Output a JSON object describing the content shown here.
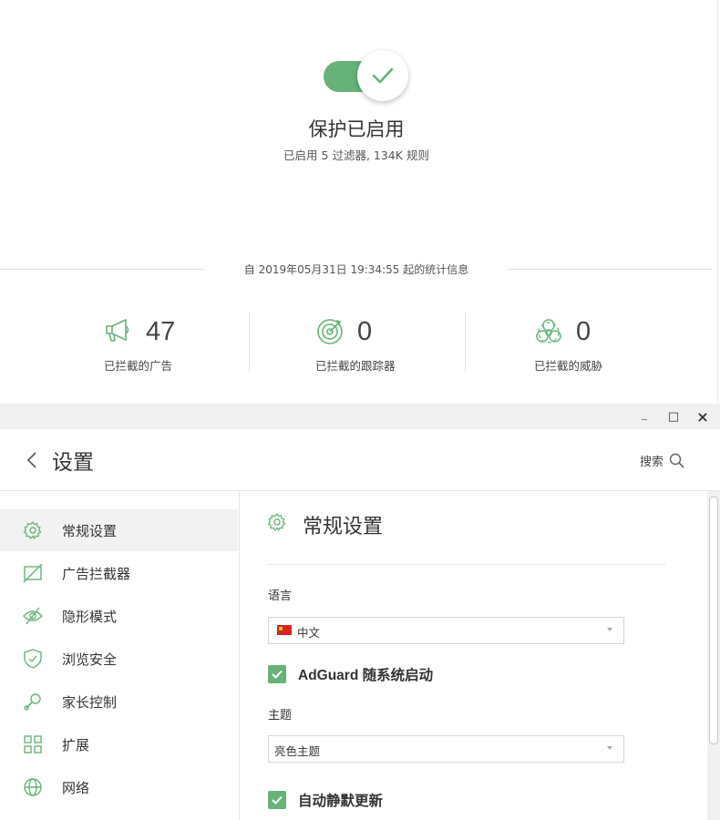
{
  "protection": {
    "title": "保护已启用",
    "subtitle": "已启用 5 过滤器, 134K 规则",
    "enabled": true
  },
  "stats": {
    "since": "自 2019年05月31日 19:34:55 起的统计信息",
    "items": [
      {
        "value": "47",
        "label": "已拦截的广告",
        "icon": "megaphone-icon"
      },
      {
        "value": "0",
        "label": "已拦截的跟踪器",
        "icon": "target-icon"
      },
      {
        "value": "0",
        "label": "已拦截的威胁",
        "icon": "biohazard-icon"
      }
    ]
  },
  "window": {
    "minimize": "_",
    "maximize": "□",
    "close": "×"
  },
  "header": {
    "title": "设置",
    "search_label": "搜索"
  },
  "sidebar": {
    "items": [
      {
        "label": "常规设置",
        "icon": "gear-icon",
        "active": true
      },
      {
        "label": "广告拦截器",
        "icon": "ad-blocker-icon",
        "active": false
      },
      {
        "label": "隐形模式",
        "icon": "eye-slash-icon",
        "active": false
      },
      {
        "label": "浏览安全",
        "icon": "shield-icon",
        "active": false
      },
      {
        "label": "家长控制",
        "icon": "rattle-icon",
        "active": false
      },
      {
        "label": "扩展",
        "icon": "grid-icon",
        "active": false
      },
      {
        "label": "网络",
        "icon": "globe-icon",
        "active": false
      }
    ]
  },
  "general": {
    "title": "常规设置",
    "language_label": "语言",
    "language_value": "中文",
    "autostart_label": "AdGuard 随系统启动",
    "autostart_checked": true,
    "theme_label": "主题",
    "theme_value": "亮色主题",
    "silent_update_label": "自动静默更新",
    "silent_update_checked": true
  },
  "colors": {
    "accent": "#67b279",
    "icon_green": "#67b279"
  }
}
